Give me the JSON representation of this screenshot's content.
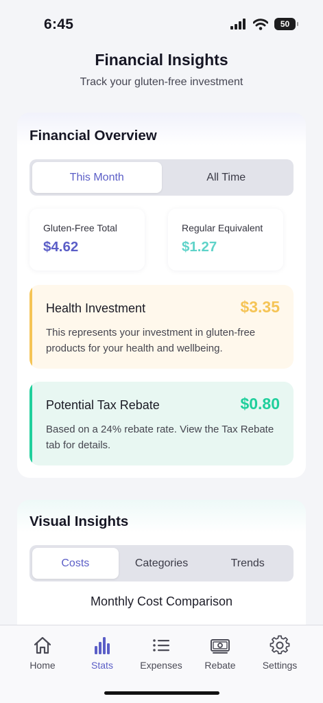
{
  "status_bar": {
    "time": "6:45",
    "battery": "50"
  },
  "header": {
    "title": "Financial Insights",
    "subtitle": "Track your gluten-free investment"
  },
  "overview": {
    "title": "Financial Overview",
    "period_tabs": [
      {
        "label": "This Month",
        "active": true
      },
      {
        "label": "All Time",
        "active": false
      }
    ],
    "stats": [
      {
        "label": "Gluten-Free Total",
        "value": "$4.62",
        "color": "#5b5ec7"
      },
      {
        "label": "Regular Equivalent",
        "value": "$1.27",
        "color": "#5fd3c9"
      }
    ],
    "health": {
      "title": "Health Investment",
      "amount": "$3.35",
      "description": "This represents your investment in gluten-free products for your health and wellbeing.",
      "accent": "#f5c456",
      "background": "#fff8ec"
    },
    "rebate": {
      "title": "Potential Tax Rebate",
      "amount": "$0.80",
      "description": "Based on a 24% rebate rate. View the Tax Rebate tab for details.",
      "accent": "#1fcf9c",
      "background": "#e8f7f2"
    }
  },
  "insights": {
    "title": "Visual Insights",
    "tabs": [
      {
        "label": "Costs",
        "active": true
      },
      {
        "label": "Categories",
        "active": false
      },
      {
        "label": "Trends",
        "active": false
      }
    ],
    "chart_title": "Monthly Cost Comparison"
  },
  "tab_bar": {
    "items": [
      {
        "label": "Home",
        "icon": "home-icon",
        "active": false
      },
      {
        "label": "Stats",
        "icon": "stats-icon",
        "active": true
      },
      {
        "label": "Expenses",
        "icon": "list-icon",
        "active": false
      },
      {
        "label": "Rebate",
        "icon": "banknote-icon",
        "active": false
      },
      {
        "label": "Settings",
        "icon": "gear-icon",
        "active": false
      }
    ]
  },
  "colors": {
    "accent": "#5b5ec7",
    "teal": "#5fd3c9",
    "gold": "#f5c456",
    "green": "#1fcf9c"
  }
}
